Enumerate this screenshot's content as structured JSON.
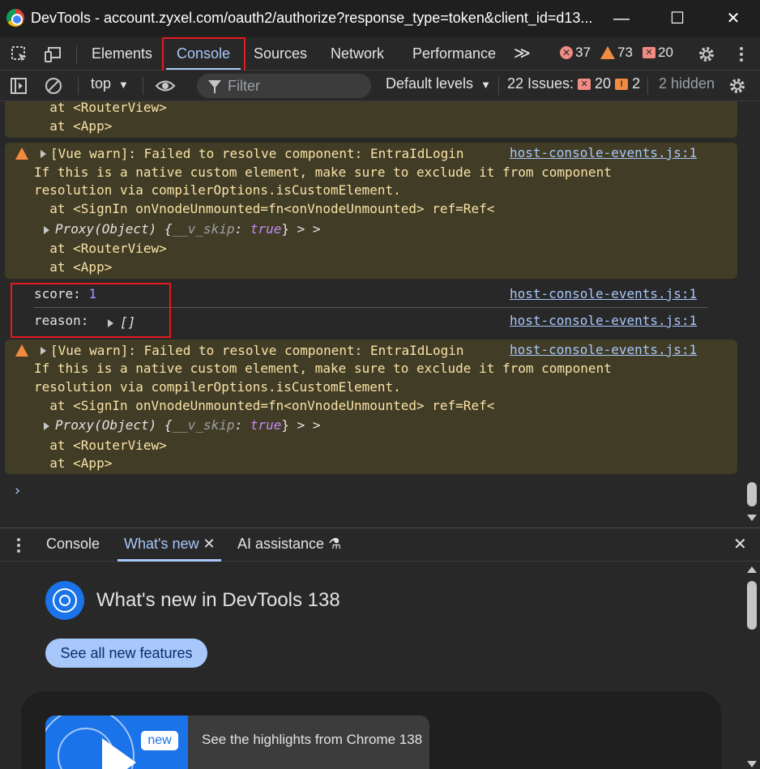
{
  "window": {
    "title": "DevTools - account.zyxel.com/oauth2/authorize?response_type=token&client_id=d13...",
    "minimize_glyph": "—",
    "maximize_glyph": "☐",
    "close_glyph": "✕"
  },
  "tabs": [
    {
      "label": "Elements"
    },
    {
      "label": "Console",
      "active": true
    },
    {
      "label": "Sources"
    },
    {
      "label": "Network"
    },
    {
      "label": "Performance"
    }
  ],
  "more_tabs_glyph": "≫",
  "counters": {
    "errors": "37",
    "warnings": "73",
    "issues": "20"
  },
  "filterbar": {
    "context": "top",
    "filter_placeholder": "Filter",
    "levels": "Default levels",
    "issues_label": "22 Issues:",
    "issues_errors": "20",
    "issues_warnings": "2",
    "hidden": "2 hidden"
  },
  "console": {
    "msg0": {
      "lines": [
        "  at <RouterView>",
        "  at <App>"
      ]
    },
    "msg1": {
      "text": "[Vue warn]: Failed to resolve component: EntraIdLogin",
      "line2": "If this is a native custom element, make sure to exclude it from component",
      "line3": "resolution via compilerOptions.isCustomElement.",
      "line4": "  at <SignIn onVnodeUnmounted=fn<onVnodeUnmounted> ref=Ref<",
      "proxy": "Proxy(Object) {",
      "prop": "__v_skip",
      "colon": ":",
      "val": "true",
      "close": "} > >",
      "line6": "  at <RouterView>",
      "line7": "  at <App>",
      "source": "host-console-events.js:1"
    },
    "score": {
      "key": "score:",
      "value": "1",
      "source": "host-console-events.js:1"
    },
    "reason": {
      "key": "reason:",
      "value": "[]",
      "source": "host-console-events.js:1"
    },
    "msg2": {
      "text": "[Vue warn]: Failed to resolve component: EntraIdLogin",
      "line2": "If this is a native custom element, make sure to exclude it from component",
      "line3": "resolution via compilerOptions.isCustomElement.",
      "line4": "  at <SignIn onVnodeUnmounted=fn<onVnodeUnmounted> ref=Ref<",
      "proxy": "Proxy(Object) {",
      "prop": "__v_skip",
      "colon": ":",
      "val": "true",
      "close": "} > >",
      "line6": "  at <RouterView>",
      "line7": "  at <App>",
      "source": "host-console-events.js:1"
    },
    "prompt": "›"
  },
  "drawer": {
    "tabs": [
      {
        "label": "Console"
      },
      {
        "label": "What's new",
        "active": true
      },
      {
        "label": "AI assistance"
      }
    ],
    "tab_close_glyph": "✕",
    "flask_glyph": "⚗",
    "close_glyph": "✕",
    "title": "What's new in DevTools 138",
    "see_all": "See all new features",
    "highlight_badge": "new",
    "highlight_text": "See the highlights from Chrome 138"
  },
  "colors": {
    "accent": "#a8c7fa",
    "warning_bg": "#413c26",
    "warning_text": "#f9e2a7",
    "annotation_red": "#e6191c"
  }
}
